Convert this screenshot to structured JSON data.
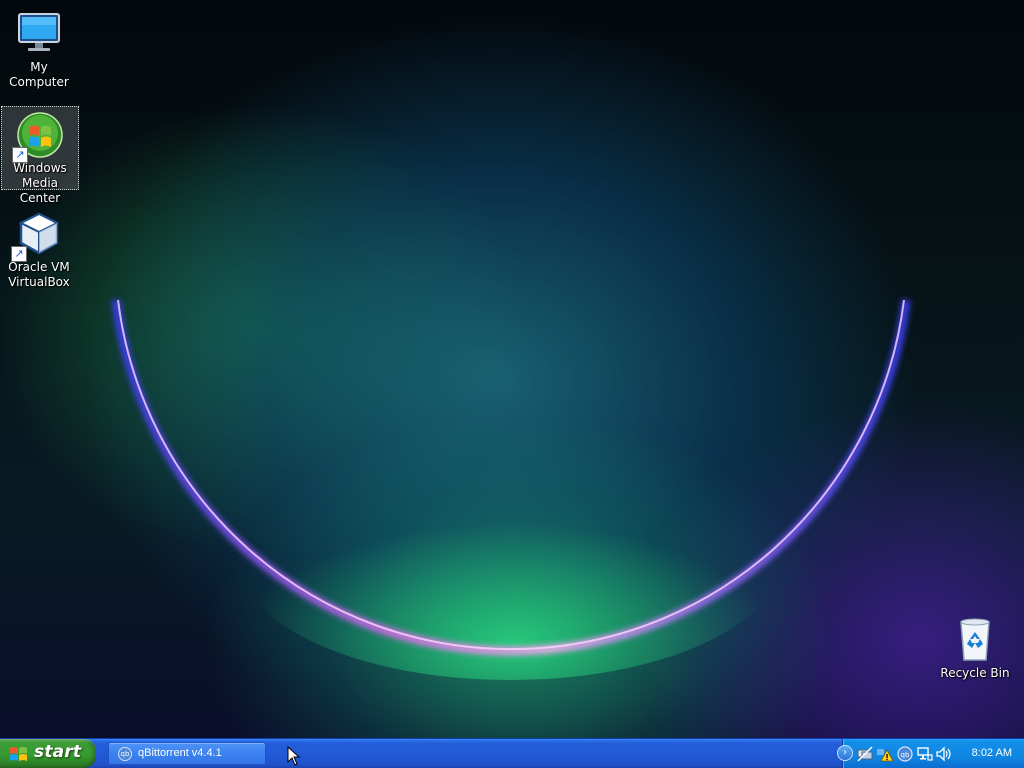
{
  "desktop": {
    "icons": [
      {
        "label": "My Computer"
      },
      {
        "label": "Windows Media Center"
      },
      {
        "label": "Oracle VM VirtualBox"
      },
      {
        "label": "Recycle Bin"
      }
    ]
  },
  "taskbar": {
    "start_label": "start",
    "tasks": [
      {
        "label": "qBittorrent v4.4.1",
        "icon": "qbittorrent-icon"
      }
    ],
    "tray": {
      "expand_glyph": "›",
      "qb_glyph": "qb",
      "clock": "8:02 AM"
    }
  },
  "colors": {
    "taskbar": "#245edb",
    "start_button": "#379a31",
    "tray": "#0f86e2"
  }
}
